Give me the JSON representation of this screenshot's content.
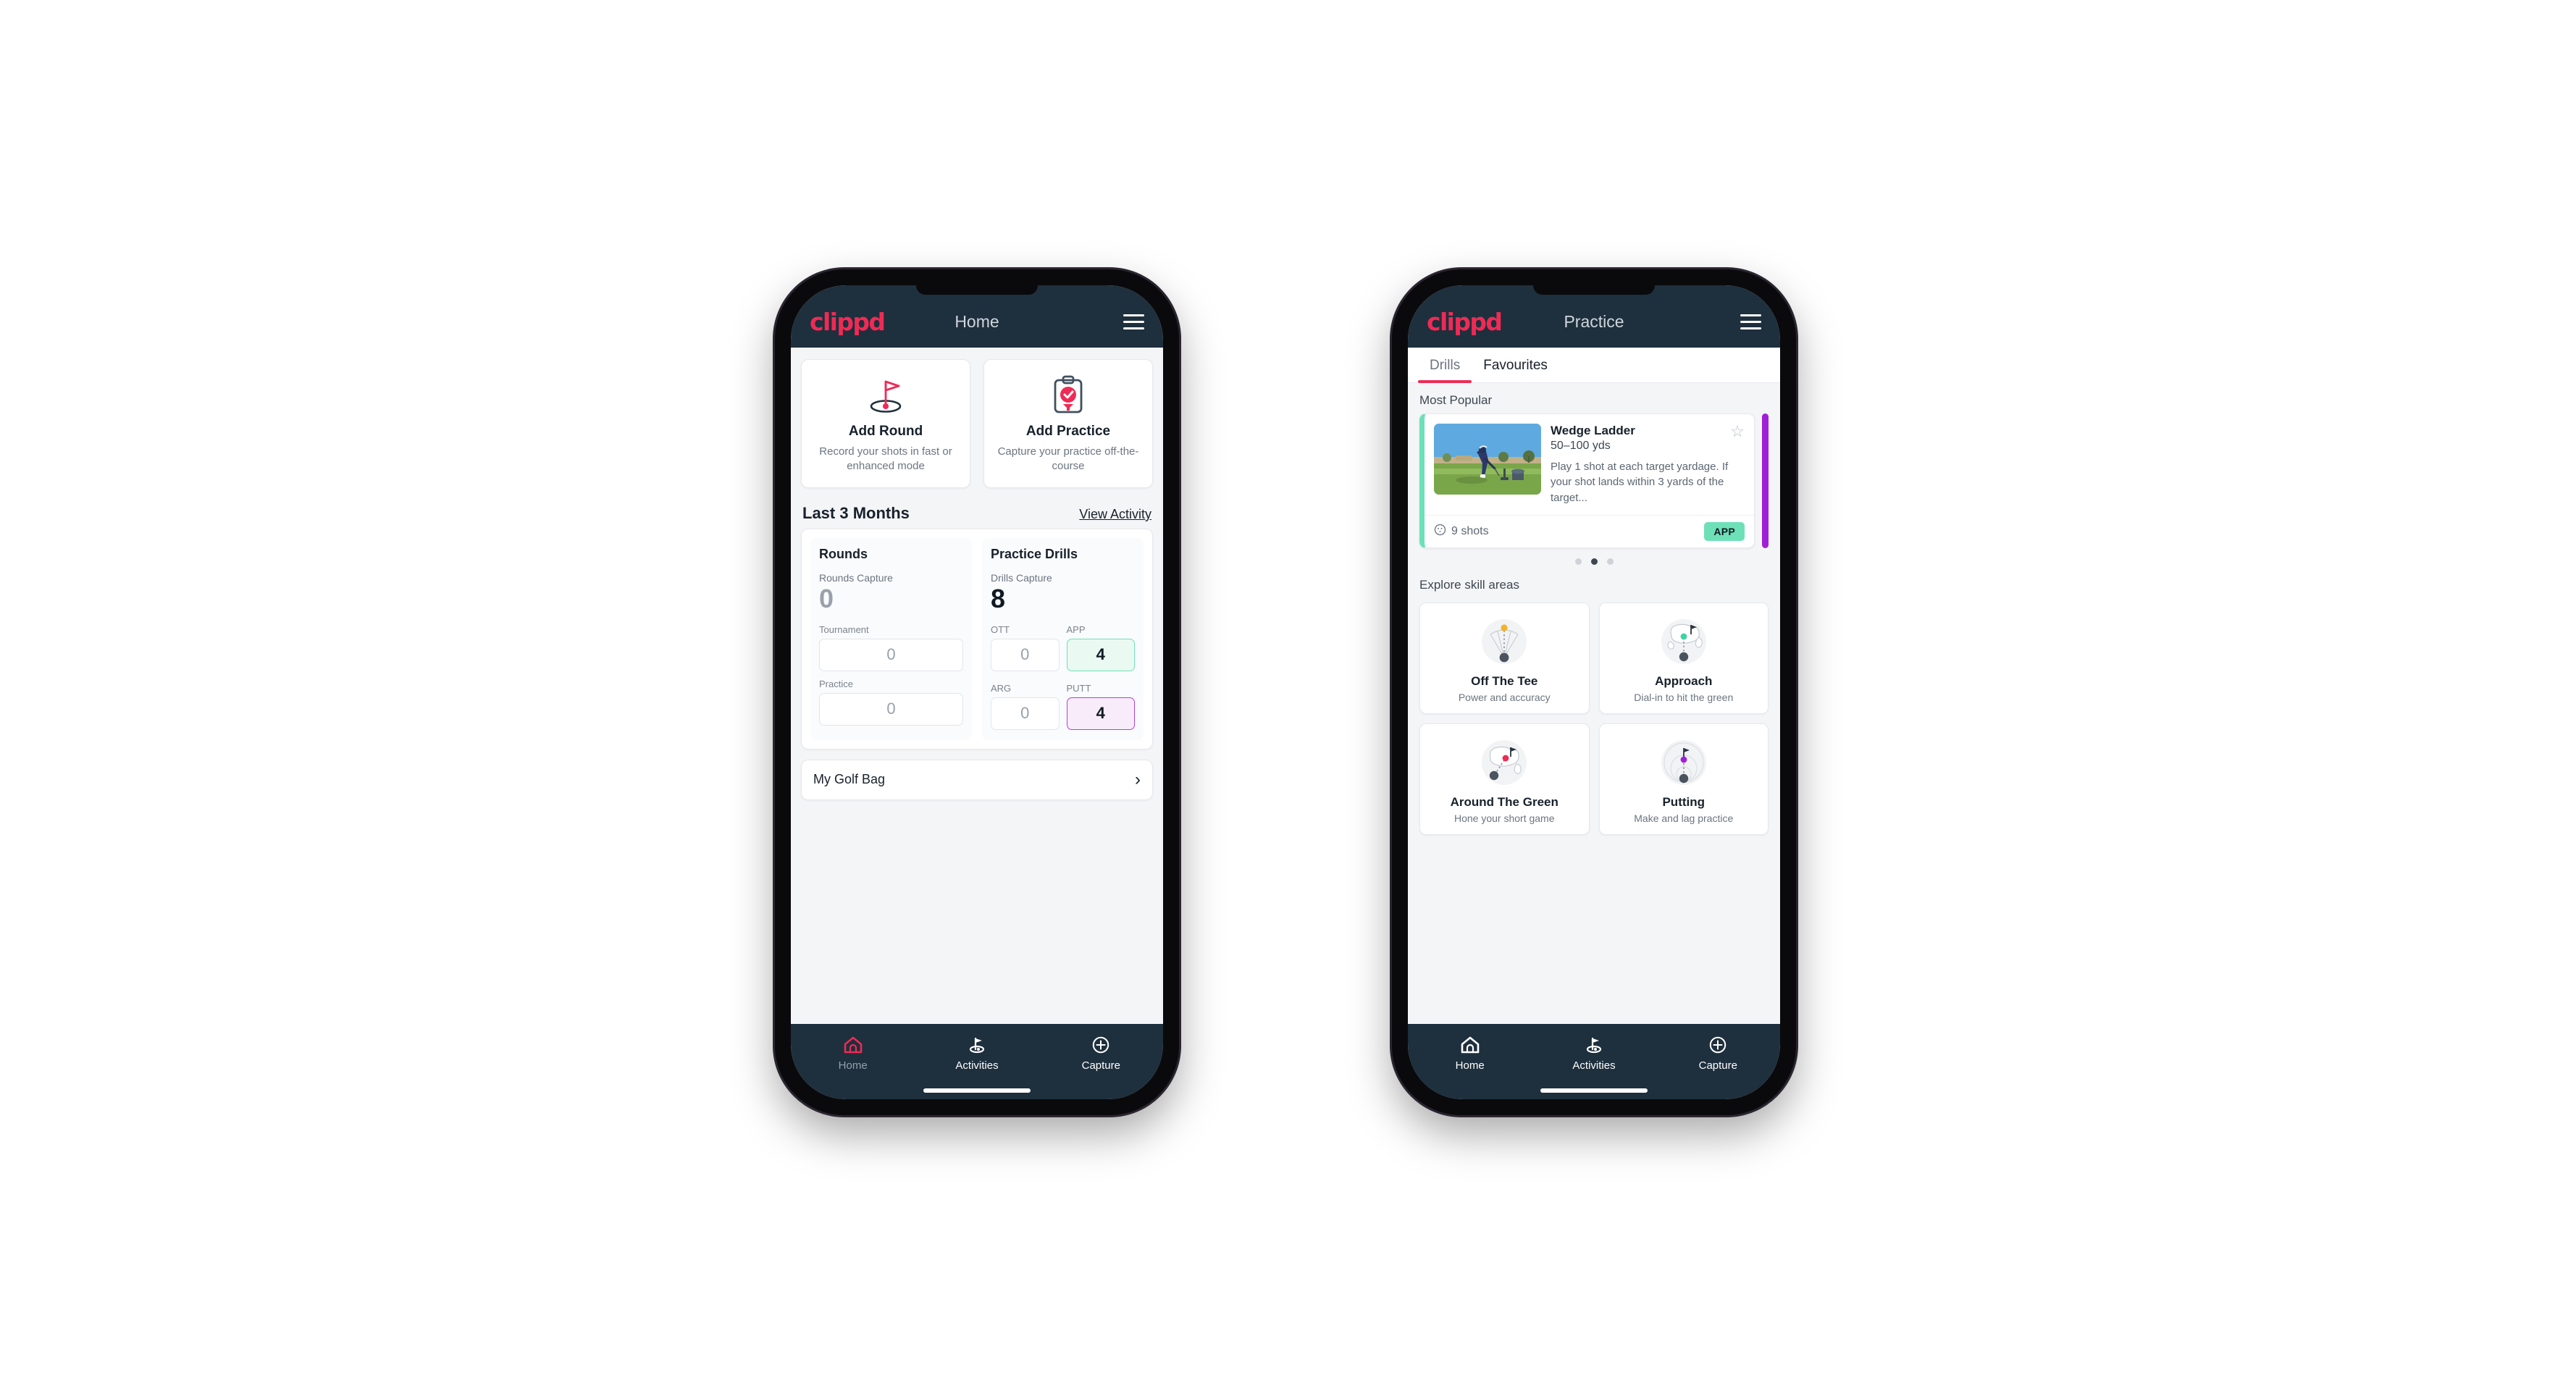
{
  "brand": {
    "name": "clippd",
    "accent": "#ee2b55",
    "navy": "#1e2f3d",
    "mint": "#6ee0b8",
    "purple": "#b341d8"
  },
  "phone_home": {
    "header": {
      "logo": "clippd",
      "title": "Home",
      "menu_icon": "hamburger-icon"
    },
    "actions": [
      {
        "icon": "golf-flag-icon",
        "title": "Add Round",
        "sub": "Record your shots in fast or enhanced mode"
      },
      {
        "icon": "clipboard-check-icon",
        "title": "Add Practice",
        "sub": "Capture your practice off-the-course"
      }
    ],
    "section": {
      "title": "Last 3 Months",
      "link": "View Activity"
    },
    "rounds": {
      "heading": "Rounds",
      "capture_label": "Rounds Capture",
      "capture_value": "0",
      "fields": [
        {
          "label": "Tournament",
          "value": "0"
        },
        {
          "label": "Practice",
          "value": "0"
        }
      ]
    },
    "drills": {
      "heading": "Practice Drills",
      "capture_label": "Drills Capture",
      "capture_value": "8",
      "fields": [
        {
          "label": "OTT",
          "value": "0",
          "style": "plain"
        },
        {
          "label": "APP",
          "value": "4",
          "style": "app"
        },
        {
          "label": "ARG",
          "value": "0",
          "style": "plain"
        },
        {
          "label": "PUTT",
          "value": "4",
          "style": "putt"
        }
      ]
    },
    "bag": {
      "label": "My Golf Bag",
      "chevron": "chevron-right-icon"
    },
    "tabbar": [
      {
        "icon": "home-icon",
        "label": "Home",
        "active": true
      },
      {
        "icon": "golf-flag-icon",
        "label": "Activities",
        "active": false
      },
      {
        "icon": "plus-circle-icon",
        "label": "Capture",
        "active": false
      }
    ]
  },
  "phone_practice": {
    "header": {
      "logo": "clippd",
      "title": "Practice",
      "menu_icon": "hamburger-icon"
    },
    "tabs": [
      {
        "label": "Drills",
        "active": true
      },
      {
        "label": "Favourites",
        "active": false
      }
    ],
    "most_popular_label": "Most Popular",
    "drill": {
      "name": "Wedge Ladder",
      "yardage": "50–100 yds",
      "description": "Play 1 shot at each target yardage. If your shot lands within 3 yards of the target...",
      "shots": "9 shots",
      "shots_icon": "golf-ball-icon",
      "badge": "APP",
      "star_icon": "star-outline-icon",
      "thumbnail": "golfer-chipping-photo"
    },
    "dots": [
      false,
      true,
      false
    ],
    "explore_label": "Explore skill areas",
    "skills": [
      {
        "icon": "tee-shot-dispersion-icon",
        "title": "Off The Tee",
        "sub": "Power and accuracy",
        "dot_color": "#f0b429"
      },
      {
        "icon": "approach-green-icon",
        "title": "Approach",
        "sub": "Dial-in to hit the green",
        "dot_color": "#3fd2a5"
      },
      {
        "icon": "chip-around-green-icon",
        "title": "Around The Green",
        "sub": "Hone your short game",
        "dot_color": "#ee2b55"
      },
      {
        "icon": "putting-rings-icon",
        "title": "Putting",
        "sub": "Make and lag practice",
        "dot_color": "#a020d8"
      }
    ],
    "tabbar": [
      {
        "icon": "home-icon",
        "label": "Home",
        "active": false
      },
      {
        "icon": "golf-flag-icon",
        "label": "Activities",
        "active": false
      },
      {
        "icon": "plus-circle-icon",
        "label": "Capture",
        "active": false
      }
    ]
  }
}
